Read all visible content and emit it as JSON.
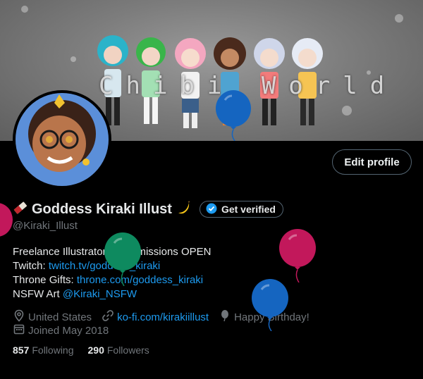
{
  "banner": {
    "title": "Chibi World"
  },
  "profile": {
    "display_name": "Goddess Kiraki Illust",
    "handle": "@Kiraki_Illust",
    "edit_label": "Edit profile",
    "verify_label": "Get verified"
  },
  "bio": {
    "line1": "Freelance Illustrator | Commissions OPEN",
    "twitch_label": "Twitch:",
    "twitch_link": "twitch.tv/goddess_kiraki",
    "throne_label": "Throne Gifts:",
    "throne_link": "throne.com/goddess_kiraki",
    "nsfw_label": "NSFW Art",
    "nsfw_link": "@Kiraki_NSFW"
  },
  "meta": {
    "location": "United States",
    "website": "ko-fi.com/kirakiillust",
    "birthday": "Happy Birthday!",
    "joined": "Joined May 2018"
  },
  "stats": {
    "following_count": "857",
    "following_label": "Following",
    "followers_count": "290",
    "followers_label": "Followers"
  },
  "colors": {
    "accent": "#1d9bf0",
    "muted": "#71767b",
    "text": "#e7e9ea",
    "balloon_pink": "#c2185b",
    "balloon_green": "#0e8a5f",
    "balloon_blue": "#1565c0"
  },
  "icons": [
    "pencil-emoji-icon",
    "banana-emoji-icon",
    "verified-badge-icon",
    "location-icon",
    "link-icon",
    "balloon-icon",
    "calendar-icon"
  ]
}
